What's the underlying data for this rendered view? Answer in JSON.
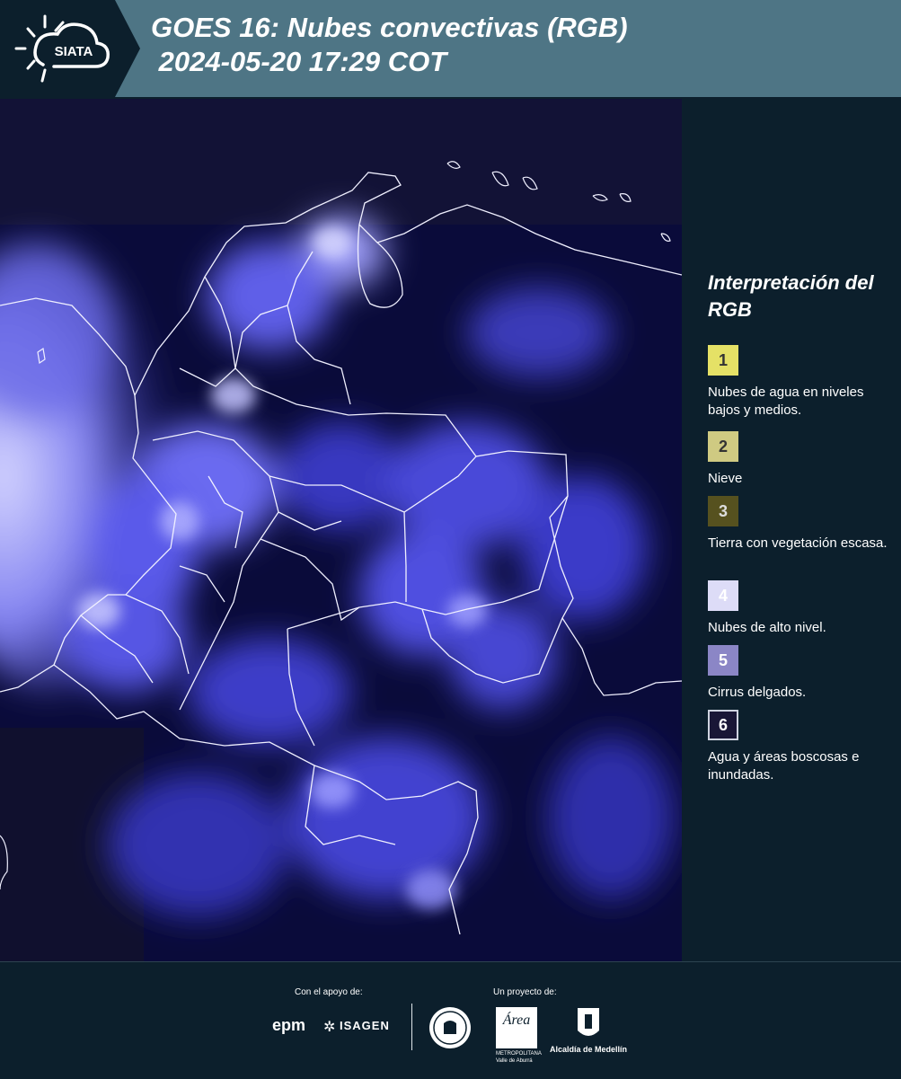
{
  "header": {
    "logo_text": "SIATA",
    "title": "GOES 16: Nubes convectivas (RGB)\n 2024-05-20 17:29 COT"
  },
  "legend": {
    "title": "Interpretación del RGB",
    "items": [
      {
        "num": "1",
        "label": "Nubes de agua en niveles bajos y medios.",
        "color": "#e5e166"
      },
      {
        "num": "2",
        "label": "Nieve",
        "color": "#cfca82"
      },
      {
        "num": "3",
        "label": "Tierra con vegetación escasa.",
        "color": "#56511f"
      },
      {
        "num": "4",
        "label": "Nubes de alto nivel.",
        "color": "#dddcf7"
      },
      {
        "num": "5",
        "label": "Cirrus delgados.",
        "color": "#8b86c6"
      },
      {
        "num": "6",
        "label": "Agua y áreas boscosas e inundadas.",
        "color": "#191636"
      }
    ]
  },
  "footer": {
    "support_label": "Con el apoyo de:",
    "project_label": "Un proyecto de:",
    "logo_epm": "epm",
    "logo_isagen": "ISAGEN",
    "logo_area": "Área",
    "logo_area_sub1": "METROPOLITANA",
    "logo_area_sub2": "Valle de Aburrá",
    "logo_alcaldia": "Alcaldía de Medellín"
  }
}
